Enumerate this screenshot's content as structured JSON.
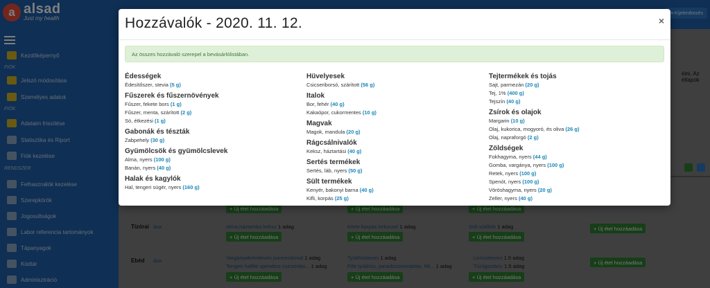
{
  "app": {
    "logo_letter": "a",
    "name": "alsad",
    "tagline": "Just my health",
    "logout_label": "Kijelentkezés"
  },
  "sidebar": {
    "items": [
      {
        "label": "Kezdőképernyő"
      },
      {
        "section": "FIÓK"
      },
      {
        "label": "Jelszó módosítása"
      },
      {
        "label": "Személyes adatok"
      },
      {
        "section": "FIÓK"
      },
      {
        "label": "Adataim frissítése"
      },
      {
        "label": "Statisztika és Riport"
      },
      {
        "label": "Fiók kezelése"
      },
      {
        "section": "RENDSZER"
      },
      {
        "label": "Felhasználók kezelése"
      },
      {
        "label": "Szerepkörök"
      },
      {
        "label": "Jogosultságok"
      },
      {
        "label": "Labor referencia tartományok"
      },
      {
        "label": "Tápanyagok"
      },
      {
        "label": "Kódtár"
      },
      {
        "label": "Adminisztráció"
      }
    ]
  },
  "background": {
    "right_text": "élni. Az étlapok",
    "meals": [
      "Tízórai",
      "Ebéd"
    ],
    "tizorai_links": [
      "Alma,háztartási keksz",
      "Körte korpás keksszel",
      "Sült sütőtök"
    ],
    "adag": "1 adag",
    "ebed_links": [
      "Vargányakrémleves parmezánnal",
      "Tengeri halfilé spenótos csicseribo...",
      "Tyúkhúsleves",
      "Főtt tyúkhús, paradicsommártás, főt...",
      "Lencseleves",
      "Túrógombóc"
    ],
    "adag_15": "1.5 adag",
    "add_food": "Új étel hozzáadása",
    "partial_asa": "ása"
  },
  "modal": {
    "title": "Hozzávalók - 2020. 11. 12.",
    "close": "×",
    "alert": "Az összes hozzávaló szerepel a bevásárlólistában.",
    "columns": [
      [
        {
          "title": "Édességek",
          "items": [
            {
              "name": "Édesítőszer, stevia",
              "qty": "(5 g)"
            }
          ]
        },
        {
          "title": "Fűszerek és fűszernövények",
          "items": [
            {
              "name": "Fűszer, fekete bors",
              "qty": "(1 g)"
            },
            {
              "name": "Fűszer, menta, szárított",
              "qty": "(2 g)"
            },
            {
              "name": "Só, étkezési",
              "qty": "(1 g)"
            }
          ]
        },
        {
          "title": "Gabonák és tészták",
          "items": [
            {
              "name": "Zabpehely",
              "qty": "(30 g)"
            }
          ]
        },
        {
          "title": "Gyümölcsök és gyümölcslevek",
          "items": [
            {
              "name": "Alma, nyers",
              "qty": "(100 g)"
            },
            {
              "name": "Banán, nyers",
              "qty": "(40 g)"
            }
          ]
        },
        {
          "title": "Halak és kagylók",
          "items": [
            {
              "name": "Hal, tengeri sügér, nyers",
              "qty": "(160 g)"
            }
          ]
        }
      ],
      [
        {
          "title": "Hüvelyesek",
          "items": [
            {
              "name": "Csicseriborsó, szárított",
              "qty": "(56 g)"
            }
          ]
        },
        {
          "title": "Italok",
          "items": [
            {
              "name": "Bor, fehér",
              "qty": "(40 g)"
            },
            {
              "name": "Kakaópor, cukormentes",
              "qty": "(10 g)"
            }
          ]
        },
        {
          "title": "Magvak",
          "items": [
            {
              "name": "Magok, mandula",
              "qty": "(20 g)"
            }
          ]
        },
        {
          "title": "Rágcsálnivalók",
          "items": [
            {
              "name": "Keksz, háztartási",
              "qty": "(40 g)"
            }
          ]
        },
        {
          "title": "Sertés termékek",
          "items": [
            {
              "name": "Sertés, láb, nyers",
              "qty": "(50 g)"
            }
          ]
        },
        {
          "title": "Sült termékek",
          "items": [
            {
              "name": "Kenyér, bakonyi barna",
              "qty": "(40 g)"
            },
            {
              "name": "Kifli, korpás",
              "qty": "(25 g)"
            }
          ]
        }
      ],
      [
        {
          "title": "Tejtermékek és tojás",
          "items": [
            {
              "name": "Sajt, parmezán",
              "qty": "(20 g)"
            },
            {
              "name": "Tej, 1%",
              "qty": "(400 g)"
            },
            {
              "name": "Tejszín",
              "qty": "(40 g)"
            }
          ]
        },
        {
          "title": "Zsírok és olajok",
          "items": [
            {
              "name": "Margarin",
              "qty": "(10 g)"
            },
            {
              "name": "Olaj, kukorica, mogyoró, és oliva",
              "qty": "(26 g)"
            },
            {
              "name": "Olaj, napraforgó",
              "qty": "(2 g)"
            }
          ]
        },
        {
          "title": "Zöldségek",
          "items": [
            {
              "name": "Fokhagyma, nyers",
              "qty": "(44 g)"
            },
            {
              "name": "Gomba, vargánya, nyers",
              "qty": "(100 g)"
            },
            {
              "name": "Retek, nyers",
              "qty": "(100 g)"
            },
            {
              "name": "Spenót, nyers",
              "qty": "(100 g)"
            },
            {
              "name": "Vöröshagyma, nyers",
              "qty": "(20 g)"
            },
            {
              "name": "Zeller, nyers",
              "qty": "(40 g)"
            }
          ]
        }
      ]
    ]
  }
}
